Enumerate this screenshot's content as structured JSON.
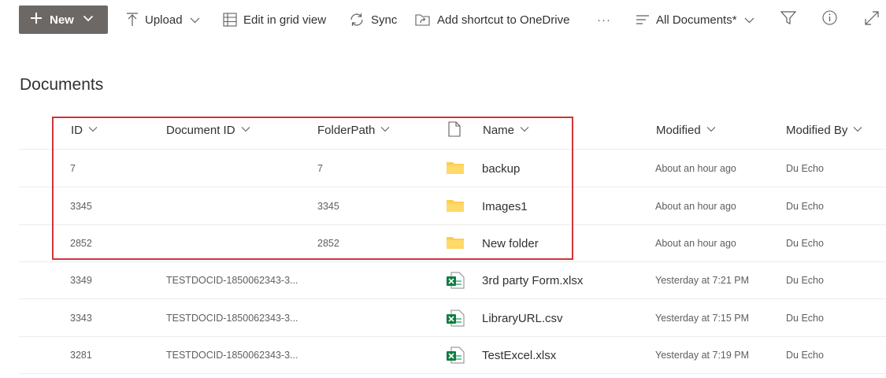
{
  "toolbar": {
    "new_label": "New",
    "upload_label": "Upload",
    "grid_label": "Edit in grid view",
    "sync_label": "Sync",
    "shortcut_label": "Add shortcut to OneDrive",
    "more_label": "···",
    "view_label": "All Documents*",
    "icons": [
      "plus-icon",
      "chevron-down-icon",
      "upload-icon",
      "grid-icon",
      "sync-icon",
      "shortcut-icon",
      "view-lines-icon",
      "filter-icon",
      "info-icon",
      "expand-icon"
    ]
  },
  "page": {
    "title": "Documents"
  },
  "table": {
    "columns": [
      "ID",
      "Document ID",
      "FolderPath",
      "Name",
      "Modified",
      "Modified By"
    ],
    "rows": [
      {
        "id": "7",
        "doc_id": "",
        "folder_path": "7",
        "type": "folder",
        "name": "backup",
        "modified": "About an hour ago",
        "modified_by": "Du Echo"
      },
      {
        "id": "3345",
        "doc_id": "",
        "folder_path": "3345",
        "type": "folder",
        "name": "Images1",
        "modified": "About an hour ago",
        "modified_by": "Du Echo"
      },
      {
        "id": "2852",
        "doc_id": "",
        "folder_path": "2852",
        "type": "folder",
        "name": "New folder",
        "modified": "About an hour ago",
        "modified_by": "Du Echo"
      },
      {
        "id": "3349",
        "doc_id": "TESTDOCID-1850062343-3...",
        "folder_path": "",
        "type": "excel",
        "name": "3rd party Form.xlsx",
        "modified": "Yesterday at 7:21 PM",
        "modified_by": "Du Echo"
      },
      {
        "id": "3343",
        "doc_id": "TESTDOCID-1850062343-3...",
        "folder_path": "",
        "type": "excel",
        "name": "LibraryURL.csv",
        "modified": "Yesterday at 7:15 PM",
        "modified_by": "Du Echo"
      },
      {
        "id": "3281",
        "doc_id": "TESTDOCID-1850062343-3...",
        "folder_path": "",
        "type": "excel",
        "name": "TestExcel.xlsx",
        "modified": "Yesterday at 7:19 PM",
        "modified_by": "Du Echo"
      }
    ]
  },
  "colors": {
    "new_button_bg": "#6b6865",
    "highlight_border": "#d13438",
    "folder_yellow": "#ffcd4d",
    "excel_green": "#107c41"
  }
}
